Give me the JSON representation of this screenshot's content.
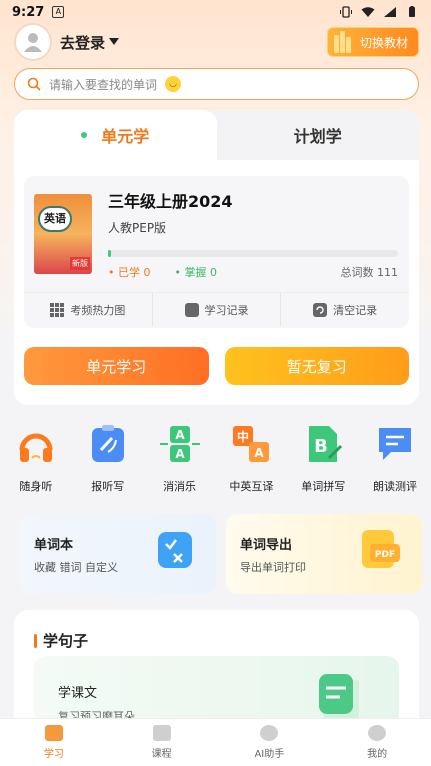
{
  "status": {
    "time": "9:27"
  },
  "header": {
    "login_label": "去登录",
    "switch_label": "切换教材"
  },
  "search": {
    "placeholder": "请输入要查找的单词"
  },
  "tabs": [
    {
      "label": "单元学"
    },
    {
      "label": "计划学"
    }
  ],
  "book": {
    "cover_label": "英语",
    "cover_tag": "新版",
    "title": "三年级上册2024",
    "edition": "人教PEP版",
    "learned_label": "已学",
    "learned_value": "0",
    "mastered_label": "掌握",
    "mastered_value": "0",
    "total_label": "总词数",
    "total_value": "111",
    "progress": 0.01
  },
  "book_actions": [
    {
      "label": "考频热力图",
      "icon": "grid-icon"
    },
    {
      "label": "学习记录",
      "icon": "record-icon"
    },
    {
      "label": "清空记录",
      "icon": "refresh-icon"
    }
  ],
  "buttons": {
    "unit_study": "单元学习",
    "no_review": "暂无复习"
  },
  "tools": [
    {
      "label": "随身听",
      "icon": "headphones-icon"
    },
    {
      "label": "报听写",
      "icon": "dictation-icon"
    },
    {
      "label": "消消乐",
      "icon": "match-game-icon"
    },
    {
      "label": "中英互译",
      "icon": "translate-icon"
    },
    {
      "label": "单词拼写",
      "icon": "spelling-icon"
    },
    {
      "label": "朗读测评",
      "icon": "read-aloud-icon"
    }
  ],
  "features": [
    {
      "title": "单词本",
      "subtitle": "收藏 错词 自定义"
    },
    {
      "title": "单词导出",
      "subtitle": "导出单词打印"
    }
  ],
  "sentence": {
    "heading": "学句子",
    "lesson_title": "学课文",
    "lesson_subtitle": "复习预习磨耳朵"
  },
  "nav": [
    {
      "label": "学习"
    },
    {
      "label": "课程"
    },
    {
      "label": "AI助手"
    },
    {
      "label": "我的"
    }
  ],
  "colors": {
    "accent": "#f07a1a",
    "green": "#3fc97a"
  }
}
